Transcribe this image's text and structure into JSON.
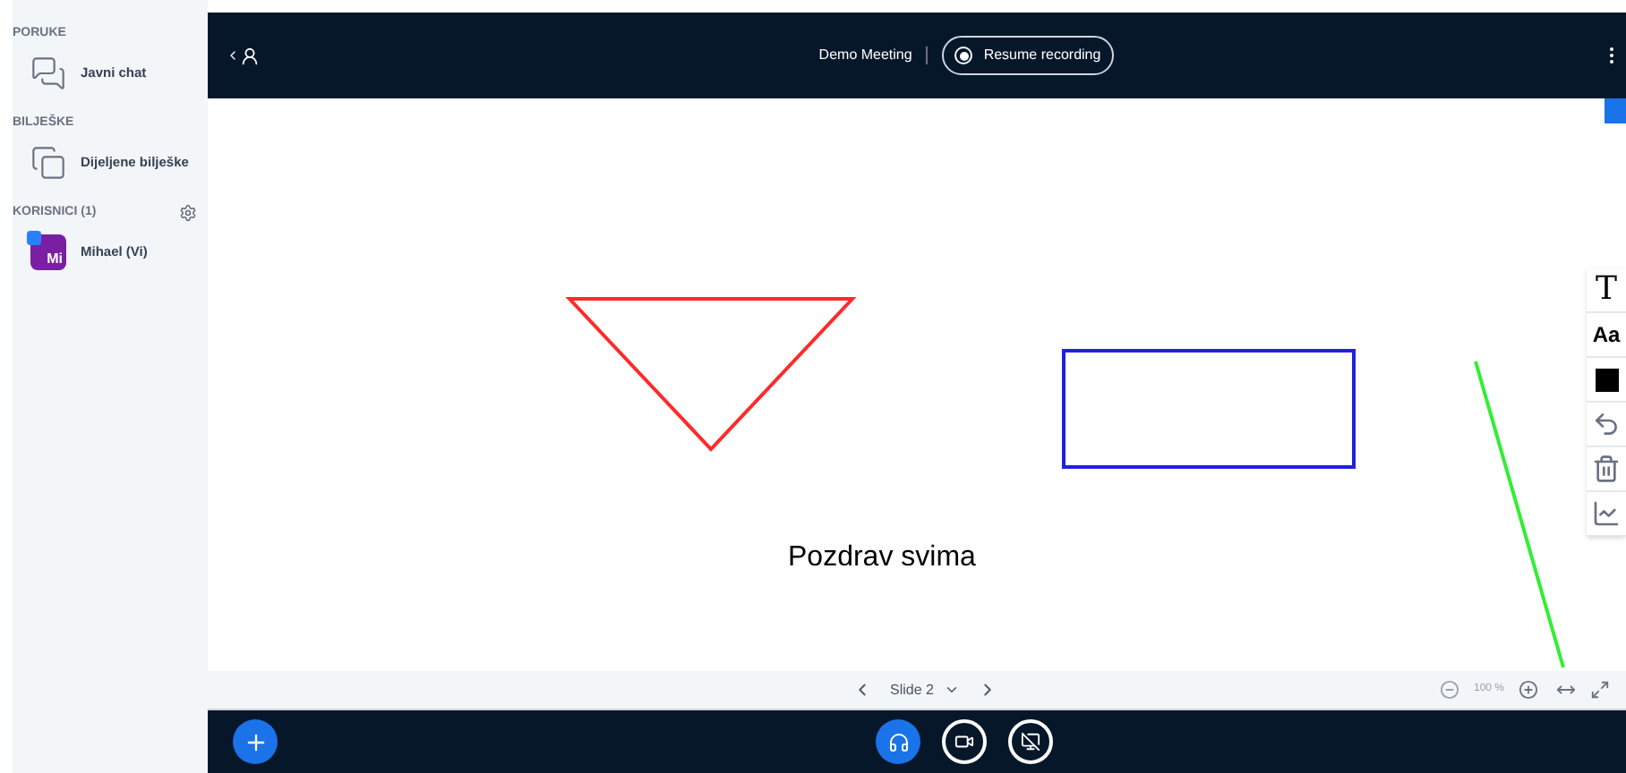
{
  "sidebar": {
    "sections": [
      {
        "title": "PORUKE",
        "items": [
          {
            "kind": "chat",
            "label": "Javni chat"
          }
        ]
      },
      {
        "title": "BILJEŠKE",
        "items": [
          {
            "kind": "notes",
            "label": "Dijeljene bilješke"
          }
        ]
      },
      {
        "title": "KORISNICI (1)",
        "items": [
          {
            "kind": "user",
            "label": "Mihael (Vi)",
            "avatar": "Mi",
            "color": "#7b1fa2"
          }
        ]
      }
    ]
  },
  "header": {
    "title": "Demo Meeting",
    "recording_button": "Resume recording"
  },
  "slide": {
    "text": "Pozdrav svima",
    "annotations": [
      {
        "kind": "triangle",
        "color": "#ff2a2a"
      },
      {
        "kind": "rectangle",
        "color": "#2020e0"
      },
      {
        "kind": "line",
        "color": "#33ee33"
      }
    ]
  },
  "whiteboard_tools": [
    {
      "kind": "text",
      "label": "T"
    },
    {
      "kind": "font",
      "label": "Aa"
    },
    {
      "kind": "color"
    },
    {
      "kind": "undo"
    },
    {
      "kind": "clear"
    },
    {
      "kind": "multiuser"
    }
  ],
  "slide_toolbar": {
    "slide": "Slide 2",
    "zoom": "100 %"
  }
}
